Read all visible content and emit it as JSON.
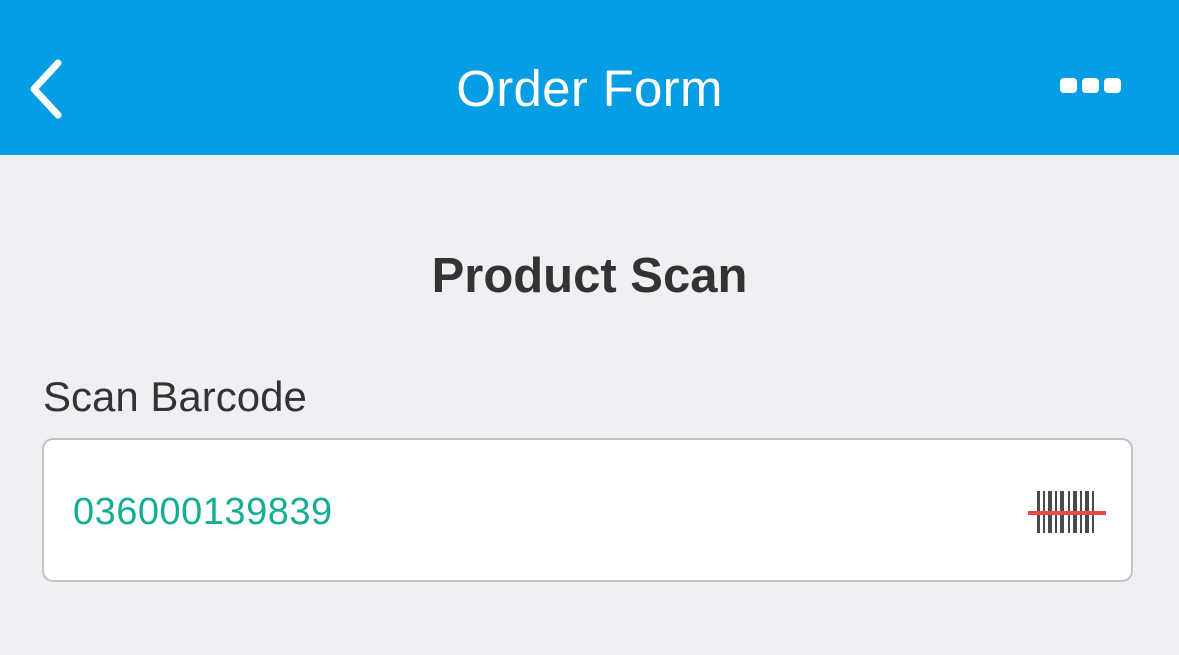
{
  "header": {
    "title": "Order Form",
    "back_icon": "chevron-left-icon",
    "more_icon": "more-horizontal-icon"
  },
  "section": {
    "title": "Product Scan"
  },
  "barcode_field": {
    "label": "Scan Barcode",
    "value": "036000139839",
    "scan_icon": "barcode-scan-icon"
  },
  "colors": {
    "header_background": "#059de4",
    "page_background": "#efeff4",
    "value_text": "#14ae94",
    "scan_line": "#e8483f"
  }
}
